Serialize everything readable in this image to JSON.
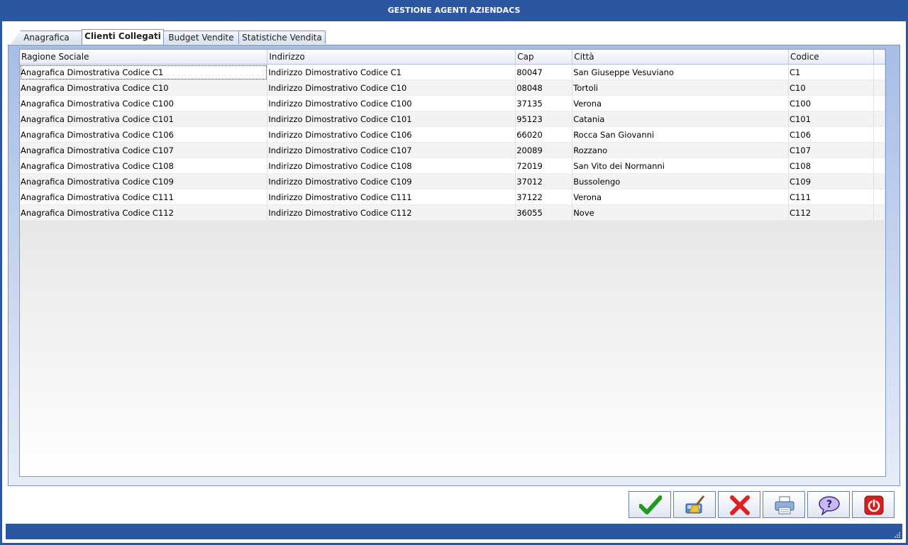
{
  "window": {
    "title": "GESTIONE AGENTI AZIENDACS"
  },
  "tabs": [
    {
      "label": "Anagrafica"
    },
    {
      "label": "Clienti Collegati"
    },
    {
      "label": "Budget Vendite"
    },
    {
      "label": "Statistiche Vendita"
    }
  ],
  "grid": {
    "columns": [
      "Ragione Sociale",
      "Indirizzo",
      "Cap",
      "Città",
      "Codice"
    ],
    "rows": [
      [
        "Anagrafica Dimostrativa Codice C1",
        "Indirizzo Dimostrativo Codice C1",
        "80047",
        "San Giuseppe Vesuviano",
        "C1"
      ],
      [
        "Anagrafica Dimostrativa Codice C10",
        "Indirizzo Dimostrativo Codice C10",
        "08048",
        "Tortoli",
        "C10"
      ],
      [
        "Anagrafica Dimostrativa Codice C100",
        "Indirizzo Dimostrativo Codice C100",
        "37135",
        "Verona",
        "C100"
      ],
      [
        "Anagrafica Dimostrativa Codice C101",
        "Indirizzo Dimostrativo Codice C101",
        "95123",
        "Catania",
        "C101"
      ],
      [
        "Anagrafica Dimostrativa Codice C106",
        "Indirizzo Dimostrativo Codice C106",
        "66020",
        "Rocca San Giovanni",
        "C106"
      ],
      [
        "Anagrafica Dimostrativa Codice C107",
        "Indirizzo Dimostrativo Codice C107",
        "20089",
        "Rozzano",
        "C107"
      ],
      [
        "Anagrafica Dimostrativa Codice C108",
        "Indirizzo Dimostrativo Codice C108",
        "72019",
        "San Vito dei Normanni",
        "C108"
      ],
      [
        "Anagrafica Dimostrativa Codice C109",
        "Indirizzo Dimostrativo Codice C109",
        "37012",
        "Bussolengo",
        "C109"
      ],
      [
        "Anagrafica Dimostrativa Codice C111",
        "Indirizzo Dimostrativo Codice C111",
        "37122",
        "Verona",
        "C111"
      ],
      [
        "Anagrafica Dimostrativa Codice C112",
        "Indirizzo Dimostrativo Codice C112",
        "36055",
        "Nove",
        "C112"
      ]
    ]
  },
  "toolbar": {
    "buttons": [
      {
        "icon": "checkmark-icon"
      },
      {
        "icon": "broom-icon"
      },
      {
        "icon": "x-icon"
      },
      {
        "icon": "printer-icon"
      },
      {
        "icon": "help-icon"
      },
      {
        "icon": "power-icon"
      }
    ]
  },
  "colors": {
    "titlebar": "#2b56a0",
    "accent": "#a7bde6"
  }
}
